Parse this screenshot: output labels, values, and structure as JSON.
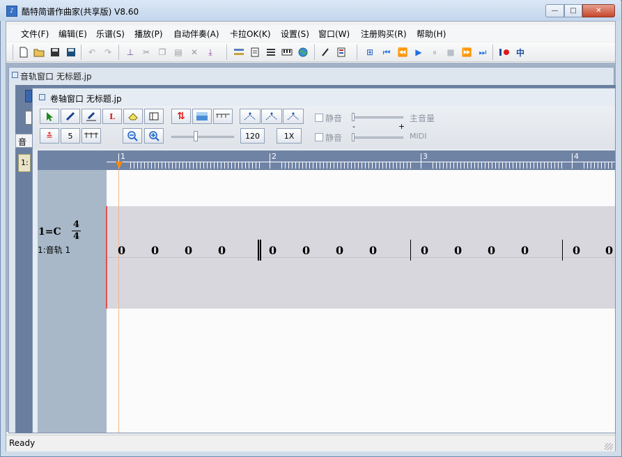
{
  "app": {
    "title": "酷特简谱作曲家(共享版) V8.60"
  },
  "window_controls": {
    "minimize": "—",
    "maximize": "□",
    "close": "✕"
  },
  "menu": [
    "文件(F)",
    "编辑(E)",
    "乐谱(S)",
    "播放(P)",
    "自动伴奏(A)",
    "卡拉OK(K)",
    "设置(S)",
    "窗口(W)",
    "注册购买(R)",
    "帮助(H)"
  ],
  "toolbar_icons": [
    "new-file-icon",
    "open-folder-icon",
    "save-icon",
    "save-all-icon",
    "undo-icon",
    "redo-icon",
    "insert-icon",
    "cut-icon",
    "copy-icon",
    "paste-icon",
    "delete-icon",
    "import-icon",
    "track-icon",
    "document-icon",
    "list-icon",
    "keyboard-icon",
    "globe-icon",
    "pen-icon",
    "note-list-icon",
    "go-start-icon",
    "first-icon",
    "rewind-icon",
    "play-icon",
    "pause-icon",
    "stop-icon",
    "fast-forward-icon",
    "last-icon",
    "record-icon",
    "split-icon"
  ],
  "track_window": {
    "title": "音轨窗口  无标题.jp",
    "left_tab_fragment": "音轨",
    "left_label_fragment": "1:"
  },
  "scroll_window": {
    "title": "卷轴窗口  无标题.jp",
    "density_value": "5",
    "tempo_value": "120",
    "speed_value": "1X",
    "mute_label_1": "静音",
    "mute_label_2": "静音",
    "main_volume_label": "主音量",
    "midi_label": "MIDI",
    "minus_label": "-",
    "plus_label": "+"
  },
  "ruler": {
    "measures": [
      "1",
      "2",
      "3",
      "4"
    ]
  },
  "score": {
    "key": "1=C",
    "time_sig_top": "4",
    "time_sig_bottom": "4",
    "track_label": "1:音轨  1",
    "notes": [
      "0",
      "0",
      "0",
      "0",
      "0",
      "0",
      "0",
      "0",
      "0",
      "0",
      "0",
      "0",
      "0",
      "0"
    ]
  },
  "status": {
    "text": "Ready"
  }
}
